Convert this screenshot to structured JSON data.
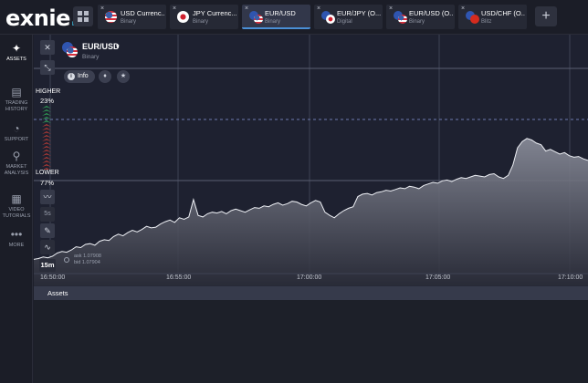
{
  "brand": {
    "logo_text": "exnie",
    "logo_dot": ".",
    "accent": "#3ec3e6"
  },
  "tabs": [
    {
      "name": "USD Currenc...",
      "kind": "Binary",
      "flag": "us"
    },
    {
      "name": "JPY Currenc...",
      "kind": "Binary",
      "flag": "jp"
    },
    {
      "name": "EUR/USD",
      "kind": "Binary",
      "flag": "eu-us",
      "active": true
    },
    {
      "name": "EUR/JPY (O...",
      "kind": "Digital",
      "flag": "eu-jp"
    },
    {
      "name": "EUR/USD (O...",
      "kind": "Binary",
      "flag": "eu-us"
    },
    {
      "name": "USD/CHF (O...",
      "kind": "Blitz",
      "flag": "us-ch"
    }
  ],
  "tab_close_glyph": "×",
  "add_tab_glyph": "+",
  "sidebar": {
    "items": [
      {
        "label": "ASSETS",
        "icon": "assets-icon",
        "glyph": "✦",
        "active": true
      },
      {
        "label": "TRADING HISTORY",
        "icon": "history-icon",
        "glyph": "▤"
      },
      {
        "label": "SUPPORT",
        "icon": "support-icon",
        "glyph": "◔"
      },
      {
        "label": "MARKET ANALYSIS",
        "icon": "analysis-icon",
        "glyph": "⚲"
      },
      {
        "label": "VIDEO TUTORIALS",
        "icon": "video-icon",
        "glyph": "▦"
      },
      {
        "label": "MORE",
        "icon": "more-icon",
        "glyph": "•••"
      }
    ]
  },
  "asset": {
    "name": "EUR/USD",
    "caret": "▾",
    "kind": "Binary",
    "info_label": "Info",
    "info_glyph": "i",
    "bell_glyph": "🔔",
    "star_glyph": "★"
  },
  "toolbar": {
    "close_glyph": "✕",
    "shrink_glyph": "⤡",
    "indicator_glyph": "〰",
    "interval_label": "5s",
    "draw_glyph": "✎",
    "chart_type_glyph": "∿",
    "expiry_label": "15m"
  },
  "sentiment": {
    "higher_label": "HIGHER",
    "higher_pct": "23%",
    "lower_label": "LOWER",
    "lower_pct": "77%",
    "higher_color": "#2f9e55",
    "lower_color": "#b03a35"
  },
  "quote": {
    "ask": "ask 1.07908",
    "bid": "bid 1.07904"
  },
  "time_axis": {
    "labels": [
      "16:50:00",
      "16:55:00",
      "17:00:00",
      "17:05:00",
      "17:10:00"
    ]
  },
  "chart_data": {
    "type": "area",
    "x_label_interval": "5 min",
    "series": [
      {
        "values": [
          10,
          11,
          13,
          12,
          14,
          18,
          20,
          19,
          22,
          26,
          25,
          29,
          30,
          28,
          33,
          35,
          34,
          39,
          42,
          40,
          44,
          47,
          45,
          48,
          52,
          50,
          51,
          55,
          58,
          60,
          57,
          63,
          61,
          64,
          86,
          66,
          64,
          68,
          70,
          69,
          71,
          68,
          72,
          74,
          72,
          70,
          73,
          76,
          75,
          78,
          77,
          80,
          82,
          79,
          81,
          84,
          83,
          80,
          78,
          82,
          85,
          83,
          70,
          66,
          63,
          68,
          72,
          75,
          77,
          90,
          93,
          94,
          92,
          95,
          96,
          98,
          97,
          99,
          101,
          100,
          103,
          102,
          100,
          104,
          106,
          108,
          107,
          110,
          111,
          109,
          112,
          114,
          113,
          115,
          117,
          116,
          115,
          118,
          119,
          115,
          113,
          117,
          130,
          152,
          160,
          164,
          162,
          158,
          156,
          148,
          150,
          147,
          144,
          146,
          142,
          140,
          141,
          138,
          136
        ]
      }
    ],
    "strike_color": "#6d7bb0",
    "fill_top": "#8c8f9c",
    "fill_bottom": "#2a2c38",
    "grid": true
  },
  "bottom": {
    "assets_label": "Assets"
  }
}
